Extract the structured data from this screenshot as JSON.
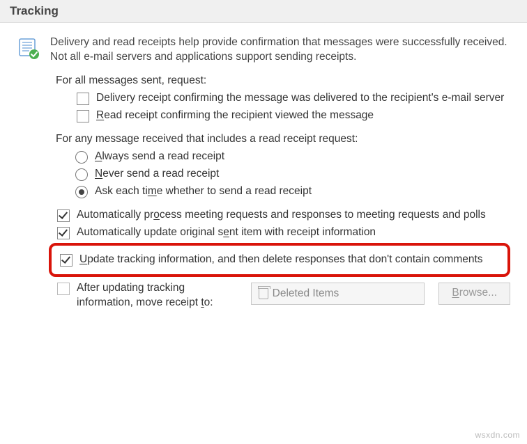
{
  "section": {
    "title": "Tracking"
  },
  "intro": "Delivery and read receipts help provide confirmation that messages were successfully received. Not all e-mail servers and applications support sending receipts.",
  "request_header": "For all messages sent, request:",
  "delivery_receipt": "Delivery receipt confirming the message was delivered to the recipient's e-mail server",
  "read_receipt_pre": "R",
  "read_receipt_rest": "ead receipt confirming the recipient viewed the message",
  "received_header": "For any message received that includes a read receipt request:",
  "radio_always_pre": "A",
  "radio_always_rest": "lways send a read receipt",
  "radio_never_pre": "N",
  "radio_never_rest": "ever send a read receipt",
  "radio_ask_pre": "Ask each ti",
  "radio_ask_mid": "m",
  "radio_ask_rest": "e whether to send a read receipt",
  "auto_process_pre": "Automatically pr",
  "auto_process_mid": "o",
  "auto_process_rest": "cess meeting requests and responses to meeting requests and polls",
  "auto_update_pre": "Automatically update original s",
  "auto_update_mid": "e",
  "auto_update_rest": "nt item with receipt information",
  "update_tracking_pre": "U",
  "update_tracking_rest": "pdate tracking information, and then delete responses that don't contain comments",
  "move_receipt_pre": "After updating tracking information, move receipt ",
  "move_receipt_mid": "t",
  "move_receipt_rest": "o:",
  "folder": "Deleted Items",
  "browse_pre": "B",
  "browse_mid": "r",
  "browse_rest": "owse...",
  "watermark": "wsxdn.com"
}
